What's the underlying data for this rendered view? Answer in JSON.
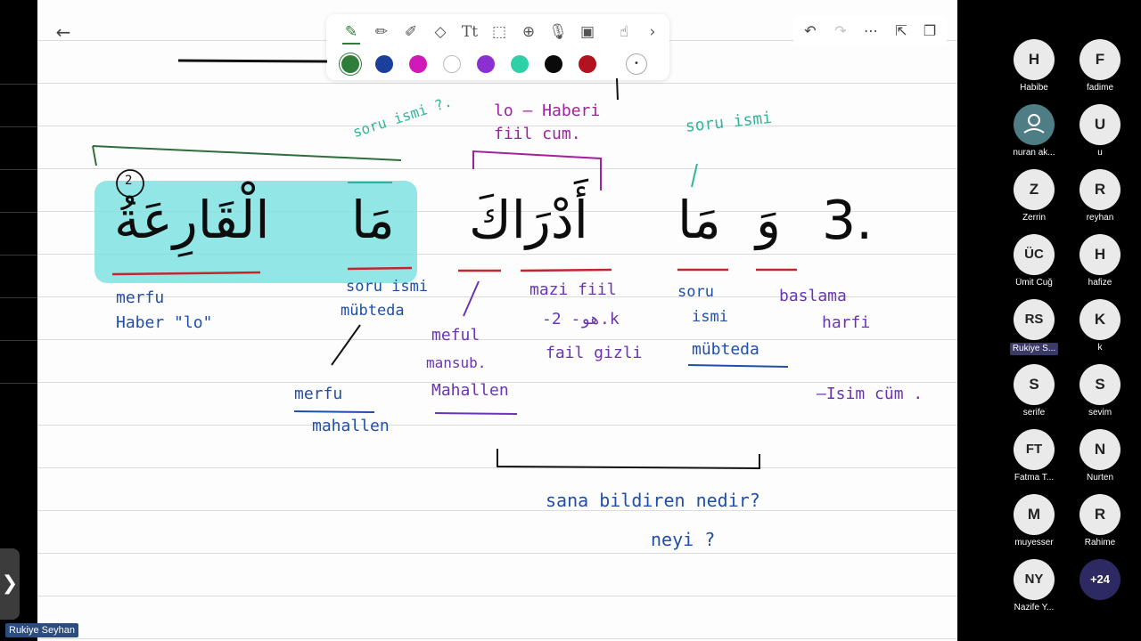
{
  "colors": {
    "pen_green": "#2f7d3b",
    "highlight_cyan": "#7fe3e2",
    "ink_pink": "#a020a0",
    "ink_teal": "#2fb69a",
    "ink_blue": "#1f4fa8",
    "ink_purple": "#6b34b4",
    "underline_red": "#c0282d"
  },
  "toolbar": {
    "tools": [
      "pen-icon",
      "pencil-icon",
      "highlighter-icon",
      "eraser-icon",
      "text-icon",
      "lasso-icon",
      "add-shape-icon",
      "microphone-icon",
      "image-icon",
      "touch-write-icon",
      "chevron-right-icon"
    ],
    "swatches": [
      "#2f7d3b",
      "#1c3f9c",
      "#d118b8",
      "#ffffff",
      "#8b2fd0",
      "#2fd0a8",
      "#0a0a0a",
      "#b3121f"
    ],
    "size_glyph": "•"
  },
  "right_tools": [
    "undo-icon",
    "redo-icon",
    "more-icon",
    "export-icon",
    "copy-pages-icon"
  ],
  "note": {
    "verse_number": "3.",
    "arabic": {
      "wa": "وَ",
      "ma1": "مَا",
      "adraka": "أَدْرَاكَ",
      "ma2": "مَا",
      "al_qaria": "الْقَارِعَةُ"
    },
    "annotations": {
      "lo_haberi": "lo — Haberi",
      "fiil_cum": "fiil cum.",
      "soru_ismi_left": "soru ismi ?.",
      "soru_ismi_right": "soru ismi",
      "circle_mark": "2",
      "merfu_haber_1": "merfu",
      "merfu_haber_2": "Haber \"lo\"",
      "soru_ismi_mubteda_1": "soru ismi",
      "soru_ismi_mubteda_2": "mübteda",
      "merfu_mahallen_1": "merfu",
      "merfu_mahallen_2": "mahallen",
      "meful_1": "meful",
      "meful_2": "mansub.",
      "meful_3": "Mahallen",
      "mazi_fiil": "mazi fiil",
      "hova_zk": "-هو- 2.k",
      "fail_gizli": "fail gizli",
      "soru_ismi_mubteda_r1": "soru",
      "soru_ismi_mubteda_r2": "ismi",
      "soru_ismi_mubteda_r3": "mübteda",
      "baslama_harfi_1": "baslama",
      "baslama_harfi_2": "harfi",
      "isim_cum": "—Isim cüm .",
      "sana_bildiren": "sana bildiren nedir?",
      "neyi": "neyi ?"
    }
  },
  "sidebar_toggle_glyph": "❯",
  "presenter_name": "Rukiye Seyhan",
  "participants": [
    {
      "initials": "H",
      "name": "Habibe"
    },
    {
      "initials": "F",
      "name": "fadime"
    },
    {
      "initials": "",
      "name": "nuran ak..."
    },
    {
      "initials": "U",
      "name": "u"
    },
    {
      "initials": "Z",
      "name": "Zerrin"
    },
    {
      "initials": "R",
      "name": "reyhan"
    },
    {
      "initials": "ÜC",
      "name": "Ümit Cuğ"
    },
    {
      "initials": "H",
      "name": "hafize"
    },
    {
      "initials": "RS",
      "name": "Rukiye S..."
    },
    {
      "initials": "K",
      "name": "k"
    },
    {
      "initials": "S",
      "name": "serife"
    },
    {
      "initials": "S",
      "name": "sevim"
    },
    {
      "initials": "FT",
      "name": "Fatma T..."
    },
    {
      "initials": "N",
      "name": "Nurten"
    },
    {
      "initials": "M",
      "name": "muyesser"
    },
    {
      "initials": "R",
      "name": "Rahime"
    },
    {
      "initials": "NY",
      "name": "Nazife Y..."
    },
    {
      "initials": "+24",
      "name": ""
    }
  ]
}
